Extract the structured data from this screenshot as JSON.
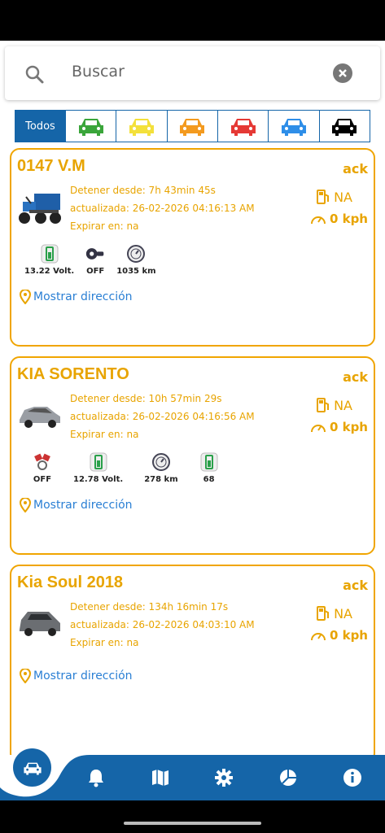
{
  "search": {
    "placeholder": "Buscar"
  },
  "filters": {
    "all_label": "Todos",
    "colors": [
      "#3aa53a",
      "#f3e03b",
      "#f39a1f",
      "#e53935",
      "#2e8ee8",
      "#000000"
    ]
  },
  "vehicles": [
    {
      "name": "0147 V.M",
      "status": "ack",
      "stopped": "Detener desde: 7h 43min 45s",
      "updated": "actualizada: 26-02-2026 04:16:13 AM",
      "expires": "Expirar en: na",
      "fuel": "NA",
      "speed": "0 kph",
      "sensors": [
        "13.22 Volt.",
        "OFF",
        "1035 km"
      ],
      "address_link": "Mostrar dirección"
    },
    {
      "name": "KIA SORENTO",
      "status": "ack",
      "stopped": "Detener desde: 10h 57min 29s",
      "updated": "actualizada: 26-02-2026 04:16:56 AM",
      "expires": "Expirar en: na",
      "fuel": "NA",
      "speed": "0 kph",
      "sensors": [
        "OFF",
        "12.78 Volt.",
        "278 km",
        "68"
      ],
      "address_link": "Mostrar dirección"
    },
    {
      "name": "Kia Soul 2018",
      "status": "ack",
      "stopped": "Detener desde: 134h 16min 17s",
      "updated": "actualizada: 26-02-2026 04:03:10 AM",
      "expires": "Expirar en: na",
      "fuel": "NA",
      "speed": "0 kph",
      "address_link": "Mostrar dirección"
    }
  ],
  "nav": [
    "car-icon",
    "bell-icon",
    "map-icon",
    "gear-icon",
    "pie-chart-icon",
    "info-icon"
  ]
}
